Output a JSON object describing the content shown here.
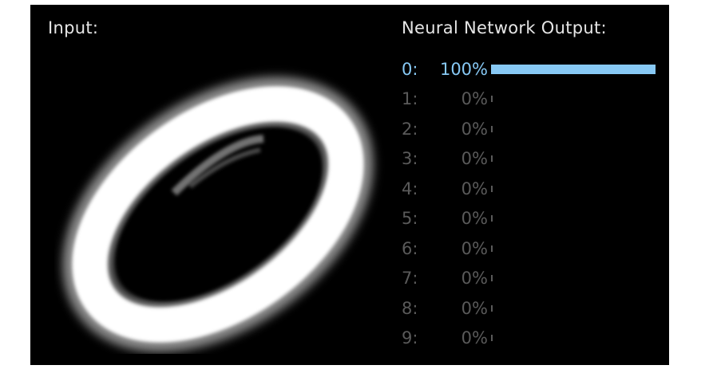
{
  "input_panel": {
    "label": "Input:"
  },
  "output_panel": {
    "label": "Neural Network Output:",
    "accent_color": "#87c9f5",
    "inactive_color": "#5a5a5a",
    "rows": [
      {
        "digit": "0:",
        "percent_text": "100%",
        "probability": 1.0,
        "active": true
      },
      {
        "digit": "1:",
        "percent_text": "0%",
        "probability": 0.0,
        "active": false
      },
      {
        "digit": "2:",
        "percent_text": "0%",
        "probability": 0.0,
        "active": false
      },
      {
        "digit": "3:",
        "percent_text": "0%",
        "probability": 0.0,
        "active": false
      },
      {
        "digit": "4:",
        "percent_text": "0%",
        "probability": 0.0,
        "active": false
      },
      {
        "digit": "5:",
        "percent_text": "0%",
        "probability": 0.0,
        "active": false
      },
      {
        "digit": "6:",
        "percent_text": "0%",
        "probability": 0.0,
        "active": false
      },
      {
        "digit": "7:",
        "percent_text": "0%",
        "probability": 0.0,
        "active": false
      },
      {
        "digit": "8:",
        "percent_text": "0%",
        "probability": 0.0,
        "active": false
      },
      {
        "digit": "9:",
        "percent_text": "0%",
        "probability": 0.0,
        "active": false
      }
    ]
  }
}
